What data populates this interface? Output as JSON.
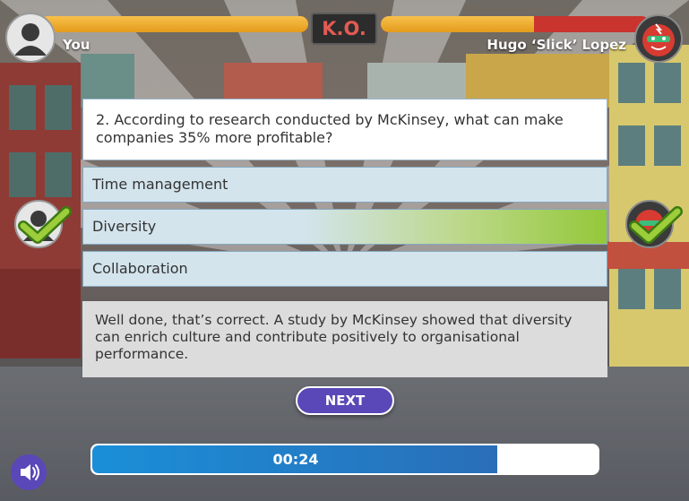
{
  "player": {
    "name": "You",
    "health": 1.0
  },
  "opponent": {
    "name": "Hugo ‘Slick’ Lopez",
    "health": 0.57
  },
  "ko_label": "K.O.",
  "question": {
    "text": "2. According to research conducted by McKinsey, what can make companies 35% more profitable?"
  },
  "answers": [
    {
      "label": "Time management",
      "state": "default"
    },
    {
      "label": "Diversity",
      "state": "correct"
    },
    {
      "label": "Collaboration",
      "state": "default"
    }
  ],
  "feedback": "Well done, that’s correct. A study by McKinsey showed that diversity can enrich culture and contribute positively to organisational performance.",
  "next_label": "NEXT",
  "timer": {
    "label": "00:24",
    "remaining": 0.8
  },
  "colors": {
    "accent": "#5a47b8",
    "correct": "#94c83a",
    "health": "#f0ae2c",
    "damage": "#c9342e"
  },
  "icons": {
    "sound": "speaker-icon",
    "check": "check-icon"
  }
}
